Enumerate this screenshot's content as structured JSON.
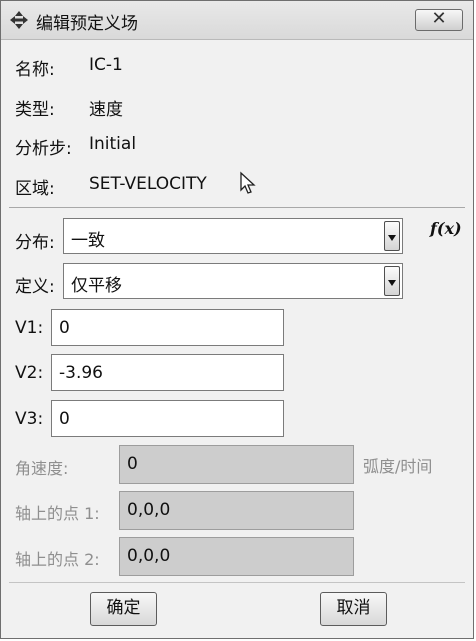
{
  "window": {
    "title": "编辑预定义场",
    "close_label": "✕"
  },
  "info": [
    {
      "label": "名称:",
      "value": "IC-1"
    },
    {
      "label": "类型:",
      "value": "速度"
    },
    {
      "label": "分析步:",
      "value": "Initial"
    },
    {
      "label": "区域:",
      "value": "SET-VELOCITY"
    }
  ],
  "form": {
    "distribution": {
      "label": "分布:",
      "value": "一致",
      "fx_label": "f(x)"
    },
    "definition": {
      "label": "定义:",
      "value": "仅平移"
    },
    "v1": {
      "label": "V1:",
      "value": "0"
    },
    "v2": {
      "label": "V2:",
      "value": "-3.96"
    },
    "v3": {
      "label": "V3:",
      "value": "0"
    },
    "angular_velocity": {
      "label": "角速度:",
      "value": "0",
      "unit": "弧度/时间"
    },
    "axis_point_1": {
      "label": "轴上的点 1:",
      "value": "0,0,0"
    },
    "axis_point_2": {
      "label": "轴上的点 2:",
      "value": "0,0,0"
    }
  },
  "buttons": {
    "ok": "确定",
    "cancel": "取消"
  }
}
